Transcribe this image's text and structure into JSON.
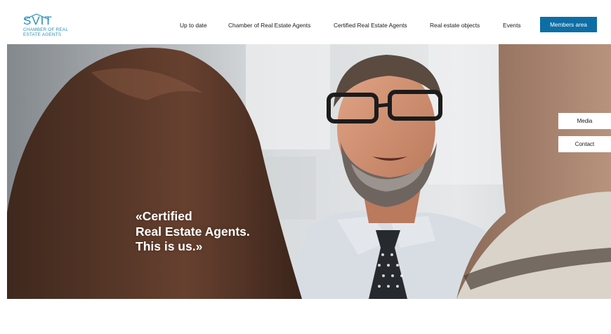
{
  "logo": {
    "mark": "SVIT",
    "line1": "CHAMBER OF REAL",
    "line2": "ESTATE AGENTS"
  },
  "nav": {
    "items": [
      {
        "label": "Up to date"
      },
      {
        "label": "Chamber of Real Estate Agents"
      },
      {
        "label": "Certified Real Estate Agents"
      },
      {
        "label": "Real estate objects"
      },
      {
        "label": "Events"
      }
    ],
    "members_label": "Members area"
  },
  "hero": {
    "quote_line1": "«Certified",
    "quote_line2": "Real Estate Agents.",
    "quote_line3": "This is us.»"
  },
  "side": {
    "media_label": "Media",
    "contact_label": "Contact"
  },
  "colors": {
    "brand": "#2a8fb8",
    "button": "#0d6ea5"
  }
}
